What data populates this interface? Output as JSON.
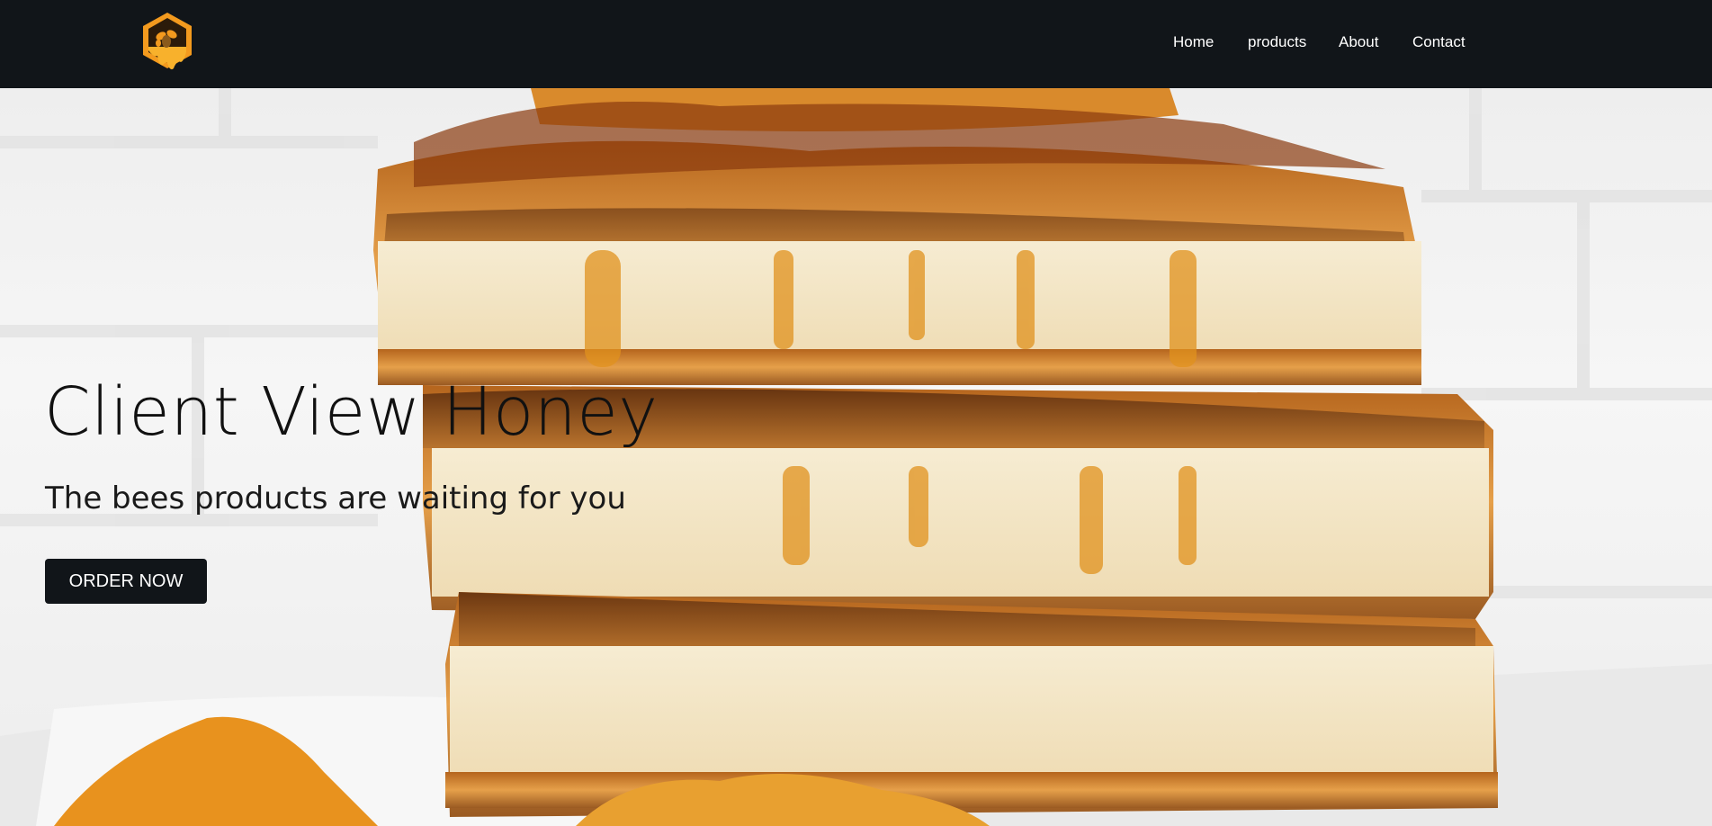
{
  "navbar": {
    "logo_icon": "honey-bee-hexagon-logo-icon",
    "links": [
      {
        "label": "Home"
      },
      {
        "label": "products"
      },
      {
        "label": "About"
      },
      {
        "label": "Contact"
      }
    ]
  },
  "hero": {
    "title": "Client View Honey",
    "subtitle": "The bees products are waiting for you",
    "cta_label": "ORDER NOW",
    "background_image": "honey-custard-pastry-photo"
  },
  "colors": {
    "navbar_bg": "#111519",
    "button_bg": "#111519",
    "logo_orange": "#f39a1e",
    "text_dark": "#111111"
  }
}
